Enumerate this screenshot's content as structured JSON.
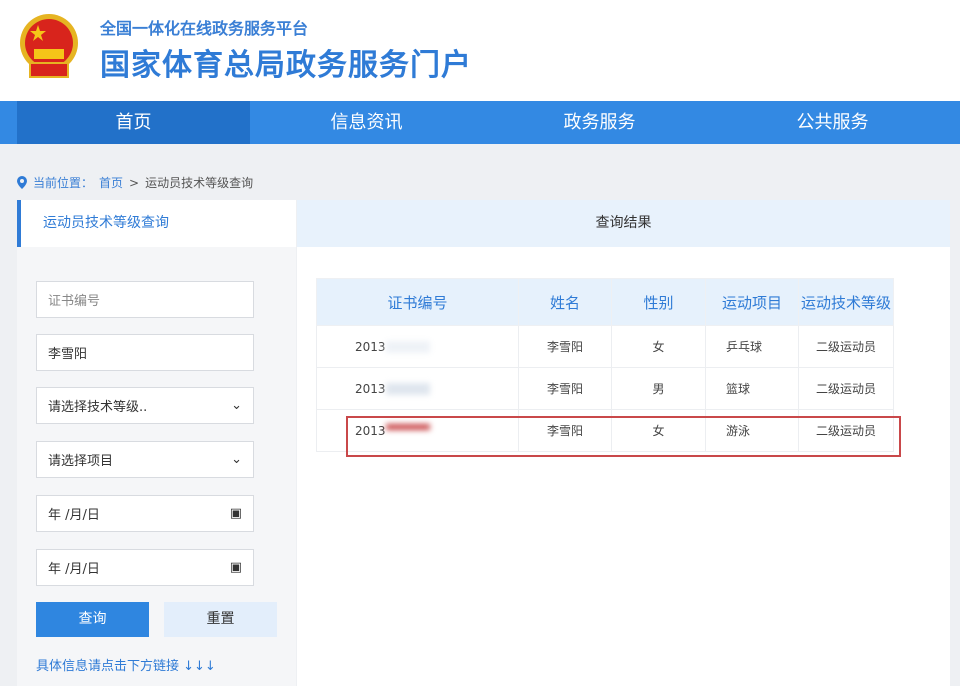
{
  "header": {
    "platform": "全国一体化在线政务服务平台",
    "title": "国家体育总局政务服务门户"
  },
  "nav": [
    {
      "label": "首页"
    },
    {
      "label": "信息资讯"
    },
    {
      "label": "政务服务"
    },
    {
      "label": "公共服务"
    }
  ],
  "breadcrumb": {
    "prefix": "当前位置：",
    "home": "首页",
    "sep": ">",
    "current": "运动员技术等级查询"
  },
  "left": {
    "tab": "运动员技术等级查询",
    "cert_placeholder": "证书编号",
    "name_value": "李雪阳",
    "level_select": "请选择技术等级..",
    "project_select": "请选择项目",
    "date1": "年 /月/日",
    "date2": "年 /月/日",
    "query": "查询",
    "reset": "重置",
    "hint": "具体信息请点击下方链接 ↓↓↓"
  },
  "right": {
    "title": "查询结果",
    "columns": [
      "证书编号",
      "姓名",
      "性别",
      "运动项目",
      "运动技术等级"
    ],
    "rows": [
      [
        "2013",
        "李雪阳",
        "女",
        "乒乓球",
        "二级运动员"
      ],
      [
        "2013",
        "李雪阳",
        "男",
        "篮球",
        "二级运动员"
      ],
      [
        "2013",
        "李雪阳",
        "女",
        "游泳",
        "二级运动员"
      ]
    ]
  },
  "colors": {
    "accent": "#2f86e0",
    "highlight": "#c9484a"
  }
}
